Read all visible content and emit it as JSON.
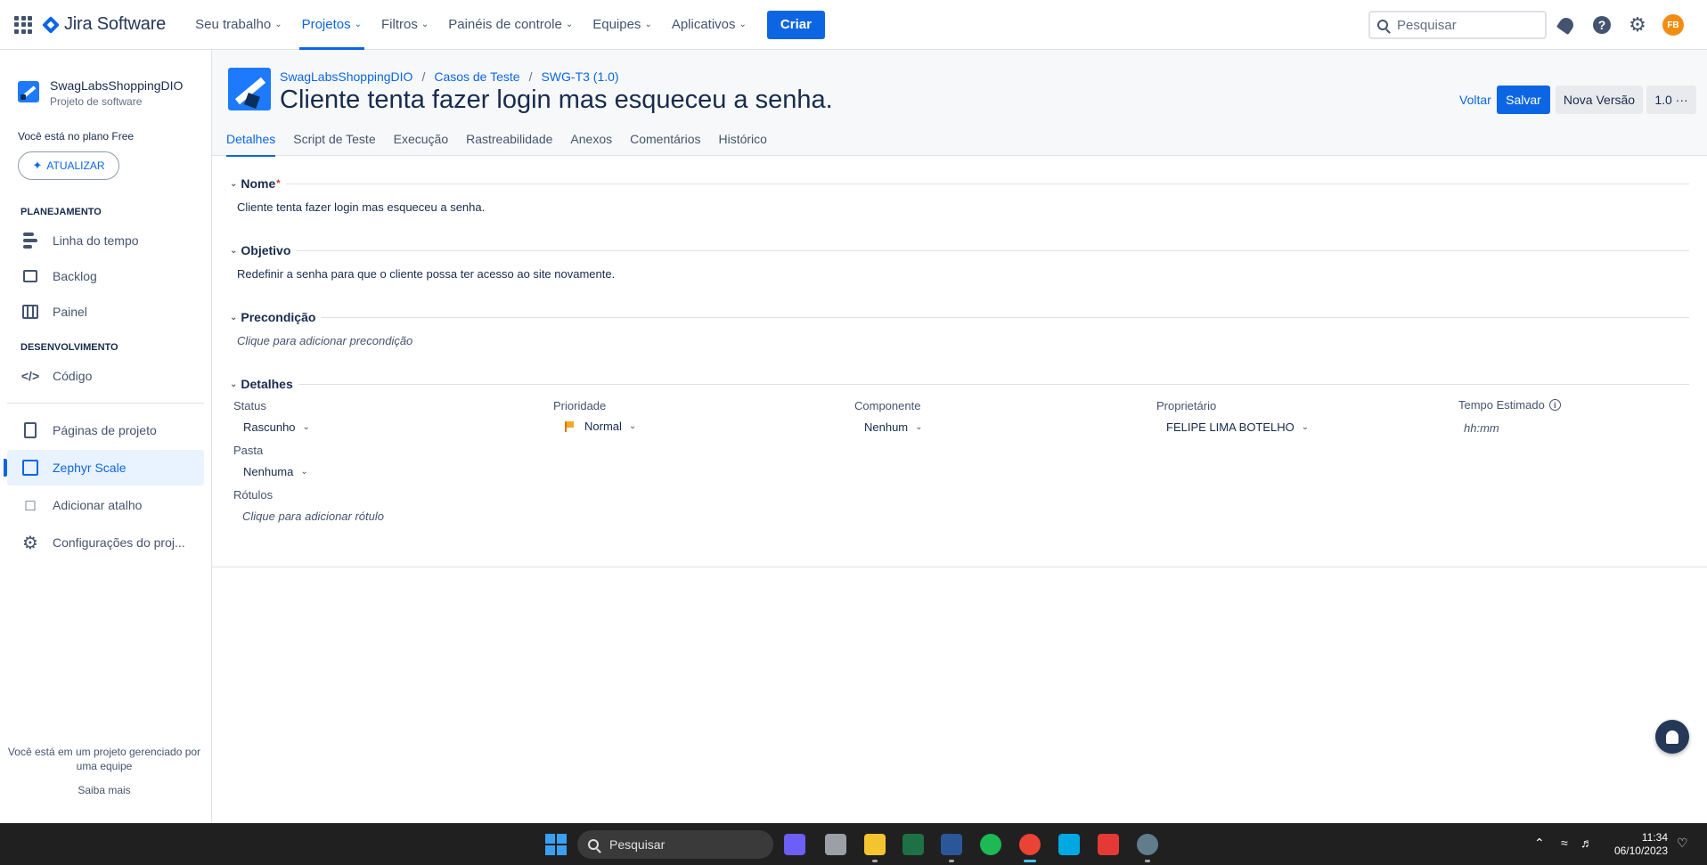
{
  "topnav": {
    "product": "Jira Software",
    "items": [
      {
        "label": "Seu trabalho",
        "active": false
      },
      {
        "label": "Projetos",
        "active": true
      },
      {
        "label": "Filtros",
        "active": false
      },
      {
        "label": "Painéis de controle",
        "active": false
      },
      {
        "label": "Equipes",
        "active": false
      },
      {
        "label": "Aplicativos",
        "active": false
      }
    ],
    "create_label": "Criar",
    "search_placeholder": "Pesquisar",
    "help_glyph": "?",
    "avatar_initials": "FB"
  },
  "sidebar": {
    "project_name": "SwagLabsShoppingDIO",
    "project_type": "Projeto de software",
    "plan_text": "Você está no plano Free",
    "upgrade_label": "ATUALIZAR",
    "planning_title": "PLANEJAMENTO",
    "planning_items": [
      {
        "label": "Linha do tempo",
        "icon": "timeline-icon"
      },
      {
        "label": "Backlog",
        "icon": "backlog-icon"
      },
      {
        "label": "Painel",
        "icon": "board-icon"
      }
    ],
    "dev_title": "DESENVOLVIMENTO",
    "dev_items": [
      {
        "label": "Código",
        "icon": "code-icon"
      }
    ],
    "other_items": [
      {
        "label": "Páginas de projeto",
        "icon": "page-icon",
        "selected": false
      },
      {
        "label": "Zephyr Scale",
        "icon": "zephyr-icon",
        "selected": true
      },
      {
        "label": "Adicionar atalho",
        "icon": "add-shortcut-icon",
        "selected": false
      },
      {
        "label": "Configurações do proj...",
        "icon": "gear-icon",
        "selected": false
      }
    ],
    "footer_note": "Você está em um projeto gerenciado por uma equipe",
    "footer_link": "Saiba mais"
  },
  "header": {
    "breadcrumb": [
      "SwagLabsShoppingDIO",
      "Casos de Teste",
      "SWG-T3 (1.0)"
    ],
    "title": "Cliente tenta fazer login mas esqueceu a senha.",
    "back_label": "Voltar",
    "save_label": "Salvar",
    "new_version_label": "Nova Versão",
    "version_label": "1.0 ···",
    "tabs": [
      "Detalhes",
      "Script de Teste",
      "Execução",
      "Rastreabilidade",
      "Anexos",
      "Comentários",
      "Histórico"
    ],
    "active_tab": "Detalhes"
  },
  "sections": {
    "name_title": "Nome",
    "name_required": "*",
    "name_value": "Cliente tenta fazer login mas esqueceu a senha.",
    "objective_title": "Objetivo",
    "objective_value": "Redefinir a senha para que o cliente possa ter acesso ao site novamente.",
    "precondition_title": "Precondição",
    "precondition_placeholder": "Clique para adicionar precondição",
    "details_title": "Detalhes"
  },
  "details": {
    "status_label": "Status",
    "status_value": "Rascunho",
    "priority_label": "Prioridade",
    "priority_value": "Normal",
    "component_label": "Componente",
    "component_value": "Nenhum",
    "owner_label": "Proprietário",
    "owner_value": "FELIPE LIMA BOTELHO",
    "estimate_label": "Tempo Estimado",
    "estimate_placeholder": "hh:mm",
    "folder_label": "Pasta",
    "folder_value": "Nenhuma",
    "labels_label": "Rótulos",
    "labels_placeholder": "Clique para adicionar rótulo"
  },
  "taskbar": {
    "search_label": "Pesquisar",
    "time": "11:34",
    "date": "06/10/2023"
  },
  "colors": {
    "accent": "#0c66e4",
    "taskbar": "#202020"
  }
}
